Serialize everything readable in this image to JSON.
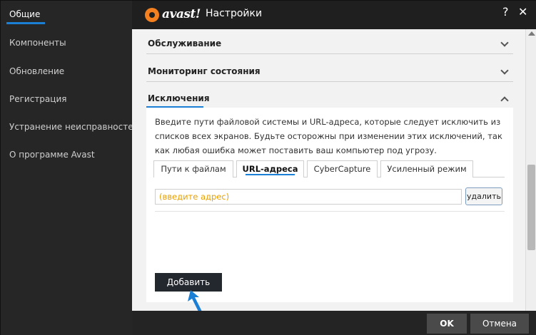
{
  "sidebar": {
    "items": [
      {
        "label": "Общие"
      },
      {
        "label": "Компоненты"
      },
      {
        "label": "Обновление"
      },
      {
        "label": "Регистрация"
      },
      {
        "label": "Устранение неисправностей"
      },
      {
        "label": "О программе Avast"
      }
    ],
    "active_index": 0
  },
  "header": {
    "logo_text": "avast!",
    "title": "Настройки",
    "help_label": "?",
    "close_label": "✕"
  },
  "sections": [
    {
      "title": "Обслуживание",
      "expanded": false
    },
    {
      "title": "Мониторинг состояния",
      "expanded": false
    },
    {
      "title": "Исключения",
      "expanded": true
    }
  ],
  "exclusions": {
    "description": "Введите пути файловой системы и URL-адреса, которые следует исключить из списков всех экранов. Будьте осторожны при изменении этих исключений, так как любая ошибка может поставить ваш компьютер под угрозу.",
    "tabs": [
      {
        "label": "Пути к файлам"
      },
      {
        "label": "URL-адреса"
      },
      {
        "label": "CyberCapture"
      },
      {
        "label": "Усиленный режим"
      }
    ],
    "active_tab": 1,
    "url_input": {
      "value": "",
      "placeholder": "(введите адрес)"
    },
    "delete_label": "удалить",
    "add_label": "Добавить"
  },
  "footer": {
    "ok_label": "OK",
    "cancel_label": "Отмена"
  },
  "colors": {
    "accent": "#1b7fd6",
    "brand": "#f4801f",
    "placeholder": "#e8a000"
  }
}
